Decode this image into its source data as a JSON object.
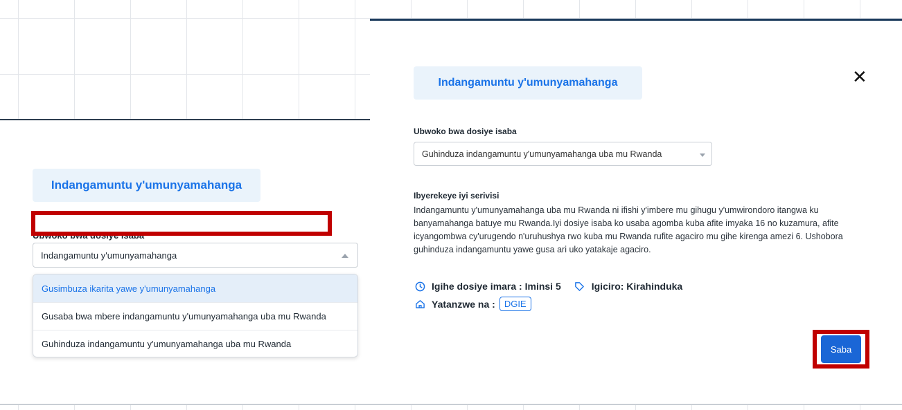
{
  "left": {
    "title": "Indangamuntu y'umunyamahanga",
    "field_label": "Ubwoko bwa dosiye isaba",
    "select_value": "Indangamuntu y'umunyamahanga",
    "options": [
      "Gusimbuza ikarita yawe y'umunyamahanga",
      "Gusaba bwa mbere indangamuntu y'umunyamahanga uba mu Rwanda",
      "Guhinduza indangamuntu y'umunyamahanga uba mu Rwanda"
    ]
  },
  "modal": {
    "title": "Indangamuntu y'umunyamahanga",
    "close_icon": "close-icon",
    "field_label": "Ubwoko bwa dosiye isaba",
    "select_value": "Guhinduza indangamuntu y'umunyamahanga uba mu Rwanda",
    "description_title": "Ibyerekeye iyi serivisi",
    "description": "Indangamuntu y'umunyamahanga uba mu Rwanda ni ifishi y'imbere mu gihugu y'umwirondoro itangwa ku banyamahanga batuye mu Rwanda.Iyi dosiye isaba ko usaba agomba kuba afite imyaka 16 no kuzamura, afite icyangombwa cy'urugendo n'uruhushya rwo kuba mu Rwanda rufite agaciro mu gihe kirenga amezi 6. Ushobora guhinduza indangamuntu yawe gusa ari uko yatakaje agaciro.",
    "processing_time": "Igihe dosiye imara : Iminsi 5",
    "price": "Igiciro: Kirahinduka",
    "provider_label": "Yatanzwe na :",
    "provider": "DGIE",
    "submit_label": "Saba"
  },
  "colors": {
    "accent": "#1a73e8",
    "highlight": "#c00000",
    "button": "#1a66d6",
    "pill_bg": "#eaf3fb"
  },
  "icons": {
    "time": "clock-icon",
    "price": "tag-icon",
    "provider": "home-icon"
  }
}
